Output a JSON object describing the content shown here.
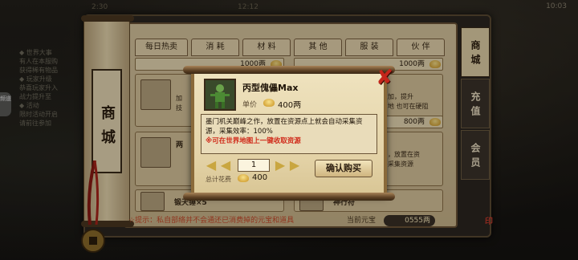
{
  "hud": {
    "top_left": "2:30",
    "top_mid": "12:12",
    "top_right": "10:03"
  },
  "chat": {
    "lines": [
      "◆ 世界大事",
      "  有人在本服购",
      "  获得稀有物品",
      "◆ 玩家升级",
      "  恭喜玩家升入",
      "  战力提升至",
      "◆ 活动",
      "  限时活动开启",
      "  请前往参加"
    ],
    "side_tab": "频道"
  },
  "shop": {
    "title": "商城",
    "tabs": [
      "每日热卖",
      "消 耗",
      "材 料",
      "其 他",
      "服 装",
      "伙 伴"
    ],
    "side_nav": [
      {
        "label": "商城",
        "active": true
      },
      {
        "label": "充值",
        "active": false
      },
      {
        "label": "会员",
        "active": false
      }
    ],
    "items": [
      {
        "price": "1000两",
        "desc1": "",
        "desc2": ""
      },
      {
        "price": "1000两",
        "desc1": "",
        "desc2": ""
      },
      {
        "price": "800两",
        "desc1": "加",
        "desc2": "技"
      },
      {
        "price": "800两",
        "desc1": "加，提升",
        "desc2": "地 也可在硬阻"
      },
      {
        "price": "",
        "desc1": "两",
        "desc2": ""
      },
      {
        "price": "",
        "desc1": "，放置在资",
        "desc2": "采集资源"
      },
      {
        "name": "锻天锤×5",
        "price": ""
      },
      {
        "name": "神行符",
        "price": ""
      }
    ],
    "notice": "☆提示：私自部络并不会通还已消费掉的元宝和道具",
    "balance_label": "当前元宝",
    "balance_value": "0555两"
  },
  "dialog": {
    "item_name": "丙型傀儡Max",
    "unit_label": "单价",
    "unit_price": "400两",
    "description": "墨门机关巅峰之作，放置在资源点上就会自动采集资源，采集效率：100%",
    "note": "※可在世界地图上一键收取资源",
    "quantity": "1",
    "total_label": "总计花费",
    "total_value": "400",
    "confirm_label": "确认购买",
    "close_icon": "close-x-icon"
  },
  "colors": {
    "accent_red": "#c4261b",
    "parchment": "#e9dcba",
    "gold": "#c9a640"
  }
}
